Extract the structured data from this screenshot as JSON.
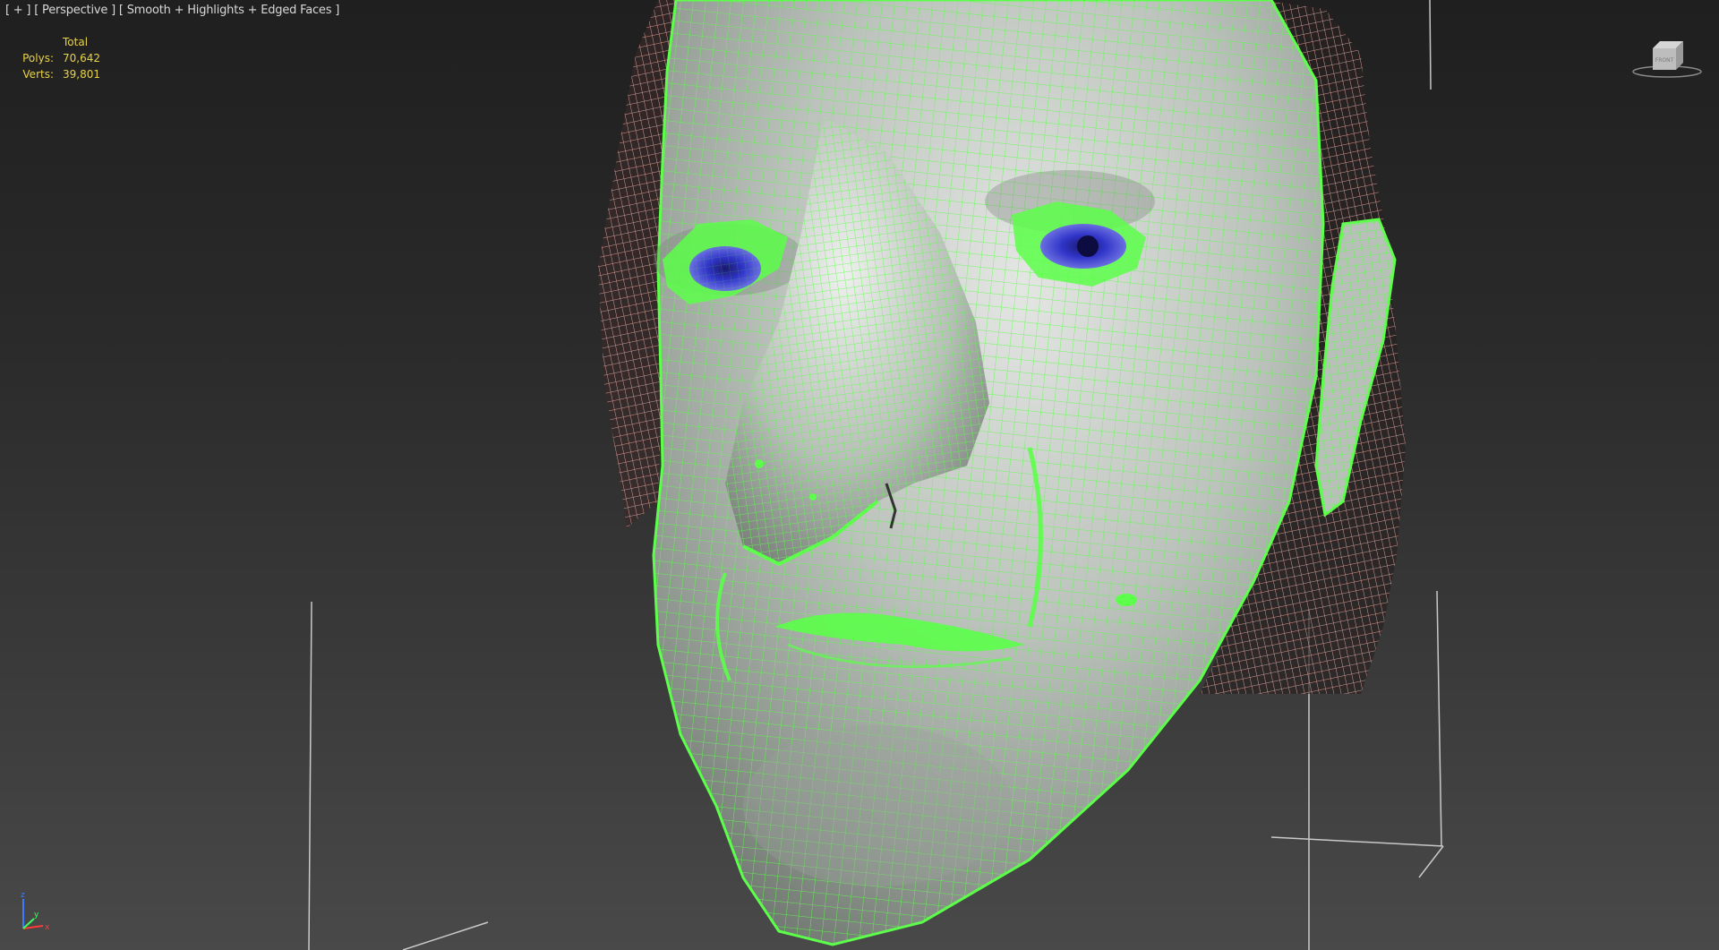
{
  "viewport": {
    "label_parts": {
      "plus": "[ + ]",
      "view": "[ Perspective ]",
      "shading": "[ Smooth + Highlights + Edged Faces ]"
    }
  },
  "stats": {
    "header": "Total",
    "polys_label": "Polys:",
    "polys_value": "70,642",
    "verts_label": "Verts:",
    "verts_value": "39,801"
  },
  "viewcube": {
    "face_label": "FRONT"
  },
  "axes": {
    "x": "x",
    "y": "y",
    "z": "z"
  },
  "colors": {
    "wire_green": "#5cff4a",
    "skin_base": "#c9cec9",
    "hair_wire": "#e6a7a0",
    "eye_blue": "#2d2fbf",
    "stats_text": "#e8d24a",
    "label_text": "#d8d8d8"
  },
  "icons": {
    "viewcube": "viewcube-icon",
    "axis_tripod": "axis-tripod-icon"
  }
}
